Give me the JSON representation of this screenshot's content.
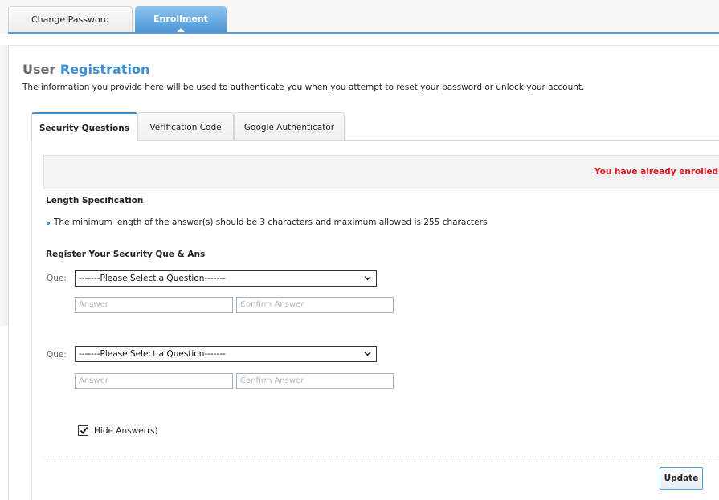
{
  "top_tabs": {
    "change_password": "Change Password",
    "enrollment": "Enrollment"
  },
  "header": {
    "title_part1": "User",
    "title_part2": "Registration",
    "intro": "The information you provide here will be used to authenticate you when you attempt to reset your password or unlock your account."
  },
  "inner_tabs": {
    "security_questions": "Security Questions",
    "verification_code": "Verification Code",
    "google_authenticator": "Google Authenticator"
  },
  "banner": {
    "message": "You have already enrolled f"
  },
  "length_spec": {
    "heading": "Length Specification",
    "rule": "The minimum length of the answer(s) should be 3 characters and maximum allowed is 255 characters"
  },
  "register": {
    "heading": "Register Your Security Que & Ans",
    "questions": [
      {
        "label": "Que:",
        "selected": "-------Please Select a Question-------",
        "answer_placeholder": "Answer",
        "confirm_placeholder": "Confirm Answer"
      },
      {
        "label": "Que:",
        "selected": "-------Please Select a Question-------",
        "answer_placeholder": "Answer",
        "confirm_placeholder": "Confirm Answer"
      }
    ]
  },
  "hide_answers": {
    "label": "Hide Answer(s)",
    "checked": true
  },
  "actions": {
    "update": "Update"
  },
  "colors": {
    "accent": "#3d8fd1",
    "error": "#e0141e"
  }
}
